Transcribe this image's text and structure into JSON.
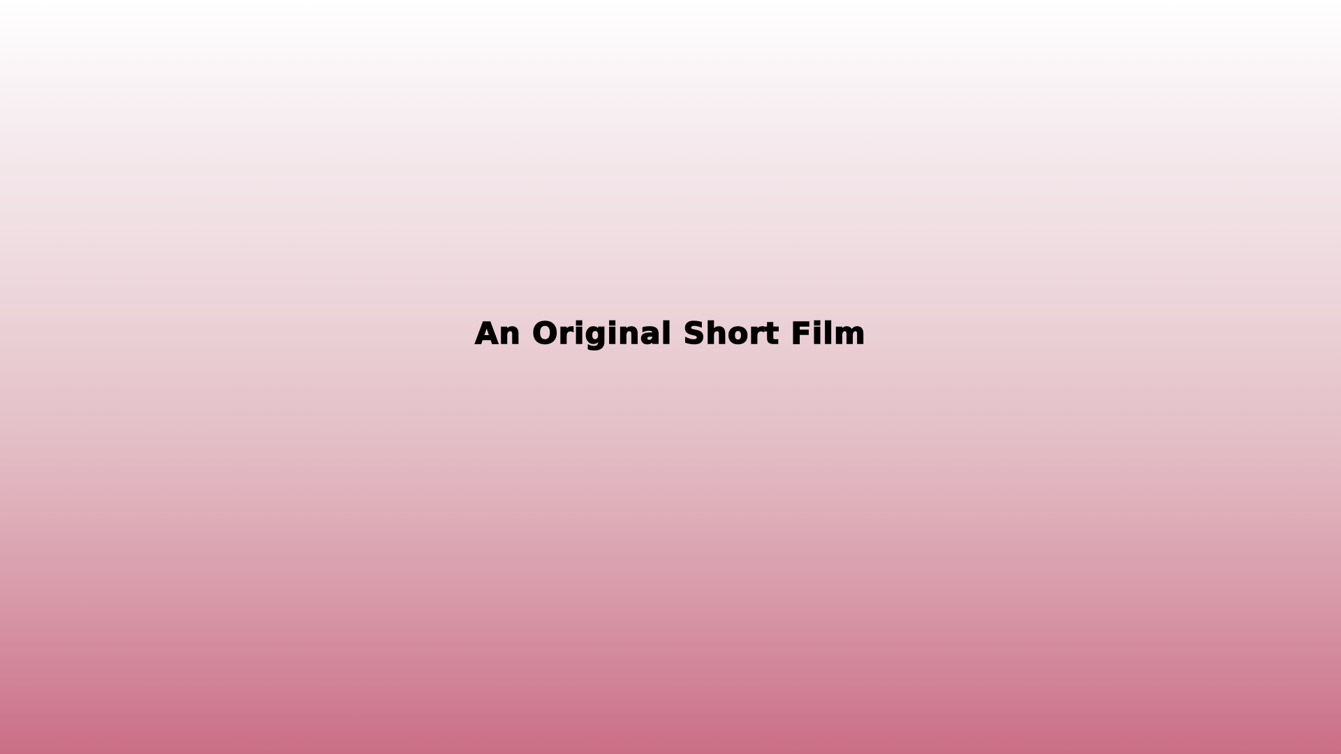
{
  "title_card": {
    "text": "An Original Short Film"
  },
  "colors": {
    "background_top": "#ffffff",
    "background_bottom": "#ca6e86",
    "text": "#000000"
  }
}
